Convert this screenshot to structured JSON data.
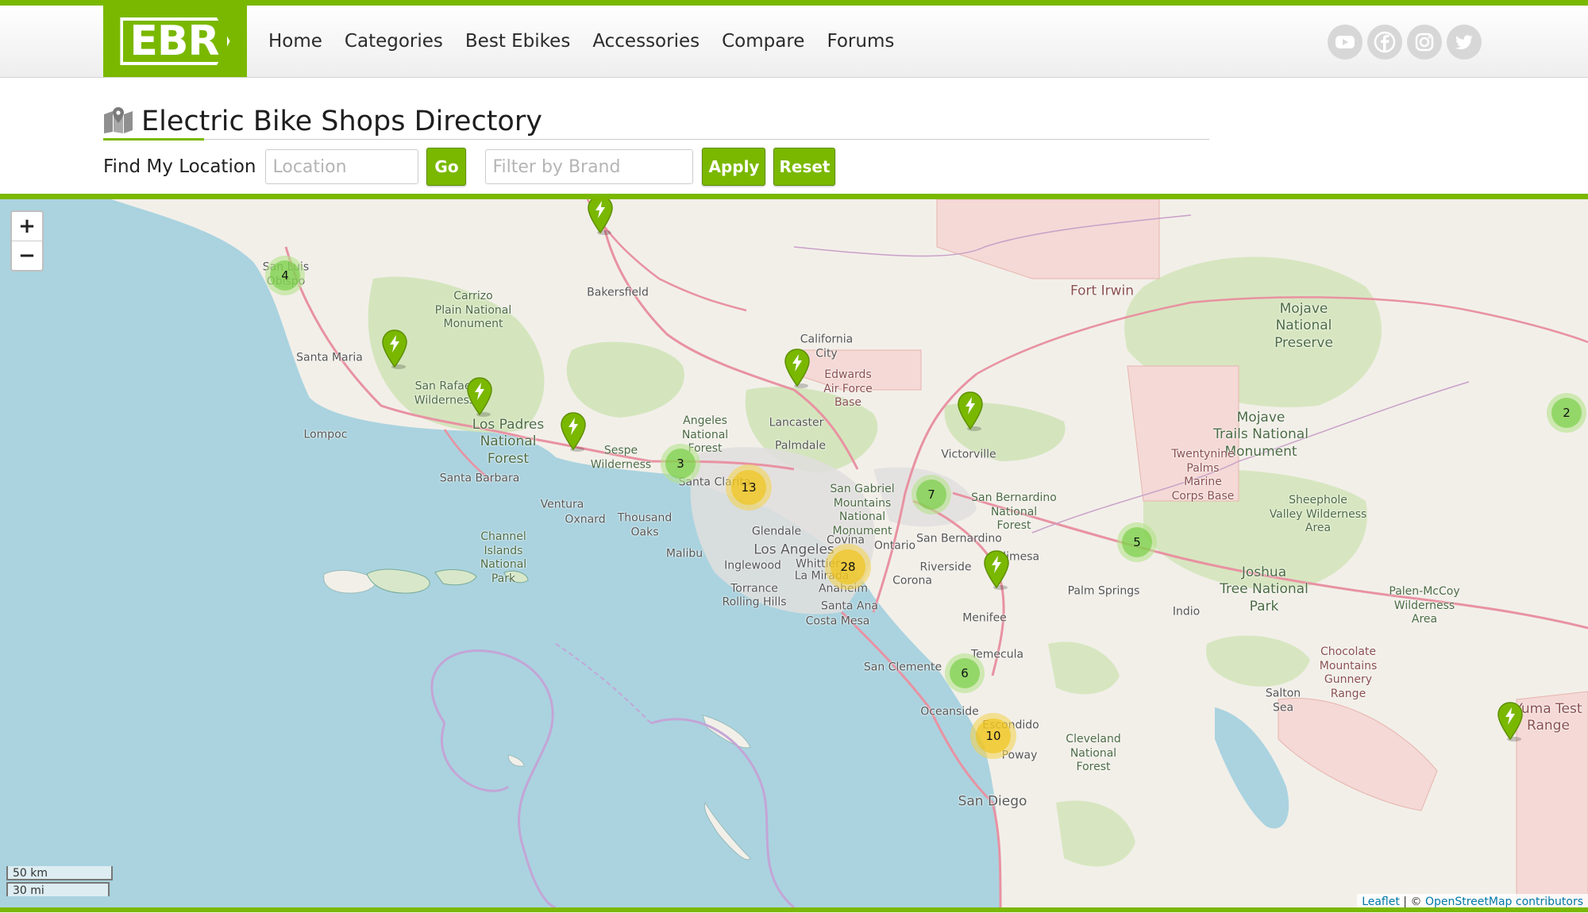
{
  "header": {
    "logo_text": "EBR",
    "nav": [
      "Home",
      "Categories",
      "Best Ebikes",
      "Accessories",
      "Compare",
      "Forums"
    ],
    "social_icons": [
      "youtube-icon",
      "facebook-icon",
      "instagram-icon",
      "twitter-icon"
    ],
    "brand_color": "#7ab800"
  },
  "page": {
    "title": "Electric Bike Shops Directory",
    "title_icon": "map-icon"
  },
  "filters": {
    "find_label": "Find My Location",
    "location_placeholder": "Location",
    "go_label": "Go",
    "brand_placeholder": "Filter by Brand",
    "apply_label": "Apply",
    "reset_label": "Reset"
  },
  "map": {
    "zoom_in": "+",
    "zoom_out": "−",
    "scale_km": "50 km",
    "scale_mi": "30 mi",
    "attribution_leaflet": "Leaflet",
    "attribution_sep": " | © ",
    "attribution_osm": "OpenStreetMap contributors",
    "clusters": [
      {
        "count": "4",
        "color": "green"
      },
      {
        "count": "3",
        "color": "green"
      },
      {
        "count": "13",
        "color": "yellow"
      },
      {
        "count": "7",
        "color": "green"
      },
      {
        "count": "5",
        "color": "green"
      },
      {
        "count": "28",
        "color": "yellow"
      },
      {
        "count": "6",
        "color": "green"
      },
      {
        "count": "10",
        "color": "yellow"
      },
      {
        "count": "2",
        "color": "green"
      }
    ],
    "labels": {
      "san_luis_obispo": "San Luis\nObispo",
      "santa_maria": "Santa Maria",
      "lompoc": "Lompoc",
      "san_rafael": "San Rafael\nWilderness",
      "carrizo": "Carrizo\nPlain National\nMonument",
      "los_padres": "Los Padres\nNational\nForest",
      "santa_barbara": "Santa Barbara",
      "ventura": "Ventura",
      "oxnard": "Oxnard",
      "thousand_oaks": "Thousand\nOaks",
      "malibu": "Malibu",
      "channel_islands": "Channel\nIslands\nNational\nPark",
      "bakersfield": "Bakersfield",
      "california_city": "California\nCity",
      "edwards": "Edwards\nAir Force\nBase",
      "lancaster": "Lancaster",
      "palmdale": "Palmdale",
      "angeles_nf": "Angeles\nNational\nForest",
      "sespe": "Sespe\nWilderness",
      "santa_clarita": "Santa Clarita",
      "glendale": "Glendale",
      "los_angeles": "Los Angeles",
      "inglewood": "Inglewood",
      "whittier": "Whittier",
      "la_mirada": "La Mirada",
      "torrance": "Torrance",
      "rolling_hills": "Rolling Hills",
      "anaheim": "Anaheim",
      "santa_ana": "Santa Ana",
      "costa_mesa": "Costa Mesa",
      "covina": "Covina",
      "ontario": "Ontario",
      "corona": "Corona",
      "riverside": "Riverside",
      "san_gabriel": "San Gabriel\nMountains\nNational\nMonument",
      "san_bernardino": "San Bernardino",
      "sb_nf": "San Bernardino\nNational\nForest",
      "calimesa": "Calimesa",
      "victorville": "Victorville",
      "fort_irwin": "Fort Irwin",
      "mojave_preserve": "Mojave\nNational\nPreserve",
      "mojave_trails": "Mojave\nTrails National\nMonument",
      "twentynine_palms": "Twentynine\nPalms\nMarine\nCorps Base",
      "sheephole": "Sheephole\nValley Wilderness\nArea",
      "joshua_tree": "Joshua\nTree National\nPark",
      "palm_springs": "Palm Springs",
      "indio": "Indio",
      "palen_mccoy": "Palen-McCoy\nWilderness\nArea",
      "menifee": "Menifee",
      "temecula": "Temecula",
      "san_clemente": "San Clemente",
      "chocolate": "Chocolate\nMountains\nGunnery\nRange",
      "salton_sea": "Salton\nSea",
      "oceanside": "Oceanside",
      "escondido": "Escondido",
      "poway": "Poway",
      "cleveland": "Cleveland\nNational\nForest",
      "san_diego": "San Diego",
      "yuma": "Yuma Test\nRange"
    }
  }
}
